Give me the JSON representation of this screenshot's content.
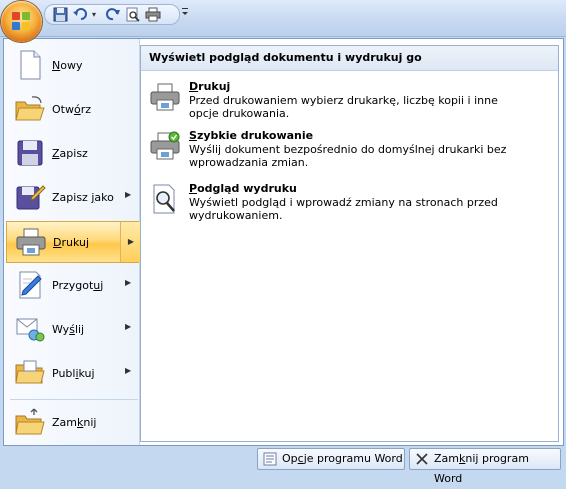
{
  "quick_access": {
    "buttons": [
      "office-button",
      "save-icon",
      "undo-icon",
      "redo-icon",
      "print-preview-icon",
      "quick-print-icon"
    ],
    "customize": "customize-quick-access-icon"
  },
  "menu": {
    "items": [
      {
        "label_pre": "",
        "label_key": "N",
        "label_post": "owy",
        "icon": "new-document-icon",
        "has_submenu": false
      },
      {
        "label_pre": "Otw",
        "label_key": "ó",
        "label_post": "rz",
        "icon": "open-folder-icon",
        "has_submenu": false
      },
      {
        "label_pre": "",
        "label_key": "Z",
        "label_post": "apisz",
        "icon": "save-icon",
        "has_submenu": false
      },
      {
        "label_pre": "Zapisz ",
        "label_key": "j",
        "label_post": "ako",
        "icon": "save-as-icon",
        "has_submenu": true
      },
      {
        "label_pre": "",
        "label_key": "D",
        "label_post": "rukuj",
        "icon": "print-icon",
        "has_submenu": true,
        "active": true
      },
      {
        "label_pre": "Przygot",
        "label_key": "u",
        "label_post": "j",
        "icon": "prepare-icon",
        "has_submenu": true
      },
      {
        "label_pre": "Wy",
        "label_key": "ś",
        "label_post": "lij",
        "icon": "send-icon",
        "has_submenu": true
      },
      {
        "label_pre": "Publ",
        "label_key": "i",
        "label_post": "kuj",
        "icon": "publish-icon",
        "has_submenu": true
      },
      {
        "label_pre": "Zam",
        "label_key": "k",
        "label_post": "nij",
        "icon": "close-document-icon",
        "has_submenu": false
      }
    ]
  },
  "submenu": {
    "header": "Wyświetl podgląd dokumentu i wydrukuj go",
    "items": [
      {
        "title_key": "D",
        "title_post": "rukuj",
        "description": "Przed drukowaniem wybierz drukarkę, liczbę kopii i inne opcje drukowania.",
        "icon": "printer-icon"
      },
      {
        "title_key": "S",
        "title_post": "zybkie drukowanie",
        "description": "Wyślij dokument bezpośrednio do domyślnej drukarki bez wprowadzania zmian.",
        "icon": "quick-print-icon"
      },
      {
        "title_key": "P",
        "title_post": "odgląd wydruku",
        "description": "Wyświetl podgląd i wprowadź zmiany na stronach przed wydrukowaniem.",
        "icon": "print-preview-icon"
      }
    ]
  },
  "footer": {
    "options_pre": "Op",
    "options_key": "c",
    "options_post": "je programu Word",
    "exit_pre": "Zam",
    "exit_key": "k",
    "exit_post": "nij program Word"
  }
}
